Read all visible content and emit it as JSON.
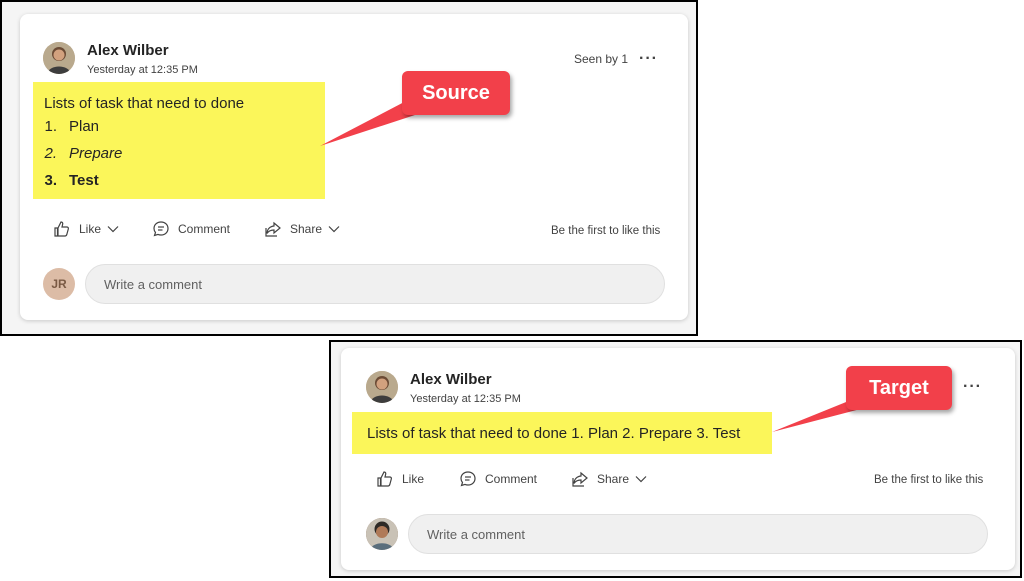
{
  "source_post": {
    "author": "Alex Wilber",
    "timestamp": "Yesterday at 12:35 PM",
    "seen_by": "Seen by 1",
    "more": "···",
    "intro": "Lists of task that need to done",
    "list": [
      {
        "num": "1.",
        "text": "Plan"
      },
      {
        "num": "2.",
        "text": "Prepare"
      },
      {
        "num": "3.",
        "text": "Test"
      }
    ],
    "actions": {
      "like": "Like",
      "comment": "Comment",
      "share": "Share",
      "first_like": "Be the first to like this"
    },
    "commenter_initials": "JR",
    "comment_placeholder": "Write a comment"
  },
  "target_post": {
    "author": "Alex Wilber",
    "timestamp": "Yesterday at 12:35 PM",
    "more": "···",
    "text": "Lists of task that need to done 1. Plan 2. Prepare 3. Test",
    "actions": {
      "like": "Like",
      "comment": "Comment",
      "share": "Share",
      "first_like": "Be the first to like this"
    },
    "comment_placeholder": "Write a comment"
  },
  "callouts": {
    "source": "Source",
    "target": "Target",
    "color": "#f2404a",
    "highlight_color": "#fbf65a"
  }
}
